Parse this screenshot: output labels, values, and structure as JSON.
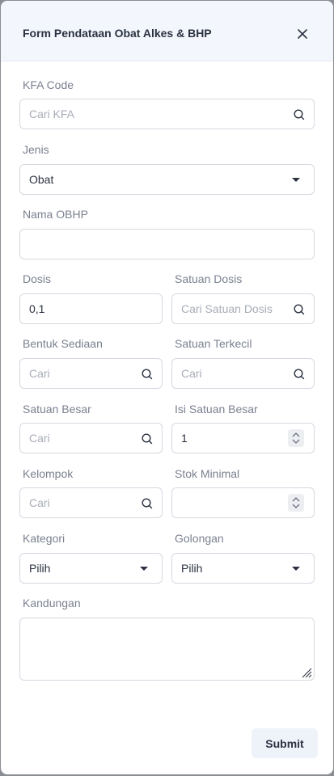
{
  "modal": {
    "title": "Form Pendataan Obat Alkes & BHP",
    "close_icon": "close-icon"
  },
  "fields": {
    "kfa_code": {
      "label": "KFA Code",
      "placeholder": "Cari KFA"
    },
    "jenis": {
      "label": "Jenis",
      "value": "Obat"
    },
    "nama_obhp": {
      "label": "Nama OBHP",
      "value": ""
    },
    "dosis": {
      "label": "Dosis",
      "value": "0,1"
    },
    "satuan_dosis": {
      "label": "Satuan Dosis",
      "placeholder": "Cari Satuan Dosis"
    },
    "bentuk_sediaan": {
      "label": "Bentuk Sediaan",
      "placeholder": "Cari"
    },
    "satuan_terkecil": {
      "label": "Satuan Terkecil",
      "placeholder": "Cari"
    },
    "satuan_besar": {
      "label": "Satuan Besar",
      "placeholder": "Cari"
    },
    "isi_satuan_besar": {
      "label": "Isi Satuan Besar",
      "value": "1"
    },
    "kelompok": {
      "label": "Kelompok",
      "placeholder": "Cari"
    },
    "stok_minimal": {
      "label": "Stok Minimal",
      "value": ""
    },
    "kategori": {
      "label": "Kategori",
      "value": "Pilih"
    },
    "golongan": {
      "label": "Golongan",
      "value": "Pilih"
    },
    "kandungan": {
      "label": "Kandungan",
      "value": ""
    }
  },
  "actions": {
    "submit_label": "Submit"
  },
  "colors": {
    "header_bg": "#f3f7fd",
    "text": "#2b3140",
    "label": "#7b8190",
    "border": "#d5d9e0"
  }
}
